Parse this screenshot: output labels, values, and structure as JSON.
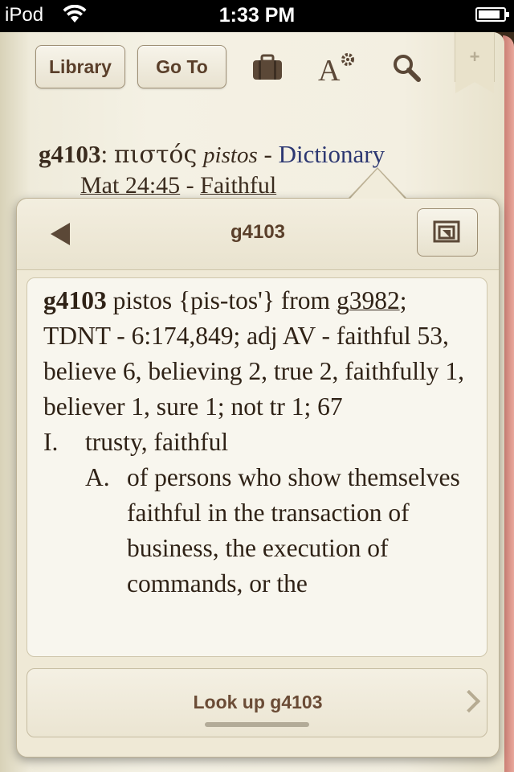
{
  "status": {
    "carrier": "iPod",
    "time": "1:33 PM"
  },
  "toolbar": {
    "library_label": "Library",
    "goto_label": "Go To",
    "ribbon_label": "+"
  },
  "heading": {
    "code": "g4103",
    "colon": ":",
    "greek": "πιστός",
    "translit": "pistos",
    "dash": "-",
    "dictionary": "Dictionary"
  },
  "reference": {
    "passage": "Mat 24:45",
    "dash": "-",
    "word": "Faithful"
  },
  "popover": {
    "title": "g4103",
    "entry": {
      "code": "g4103",
      "intro": "pistos {pis-tos'} from",
      "link": "g3982",
      "tdnt": "; TDNT - 6:174,849; adj",
      "usage": "AV - faithful 53, believe 6, believing 2, true 2, faithfully 1, believer 1, sure 1; not tr 1; 67",
      "items": [
        {
          "num": "I.",
          "text": "trusty, faithful"
        },
        {
          "num": "A.",
          "text": "of persons who show themselves faithful in the transaction of business, the execution of commands, or the"
        }
      ]
    },
    "lookup_label": "Look up g4103"
  },
  "colors": {
    "accent_blue": "#2d3872",
    "brown_text": "#5a3f2a",
    "page_edge": "#c77a70"
  }
}
